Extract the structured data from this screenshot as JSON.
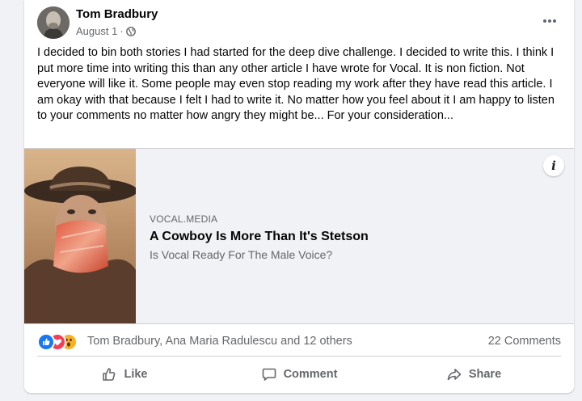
{
  "post": {
    "author": "Tom Bradbury",
    "date": "August 1",
    "dot": "·",
    "privacy_icon": "globe-icon",
    "text": "I decided to bin both stories I had started for the deep dive challenge. I decided to write this. I think I put more time into writing this than any other article I have wrote for Vocal. It is non fiction. Not everyone will like it. Some people may even stop reading my work after they have read this article. I am okay with that because I felt I had to write it. No matter how you feel about it I am happy to listen to your comments no matter how angry they might be... For your consideration..."
  },
  "link": {
    "domain": "VOCAL.MEDIA",
    "title": "A Cowboy Is More Than It's Stetson",
    "subtitle": "Is Vocal Ready For The Male Voice?",
    "info_icon": "i"
  },
  "reactions": {
    "icons": [
      "like-reaction-icon",
      "love-reaction-icon",
      "wow-reaction-icon"
    ],
    "names": "Tom Bradbury, Ana Maria Radulescu and 12 others",
    "comments": "22 Comments"
  },
  "actions": {
    "like": "Like",
    "comment": "Comment",
    "share": "Share"
  },
  "colors": {
    "like_blue": "#1877f2",
    "love_red": "#f33e58",
    "wow_yellow": "#f7b125",
    "secondary_text": "#65676b"
  }
}
